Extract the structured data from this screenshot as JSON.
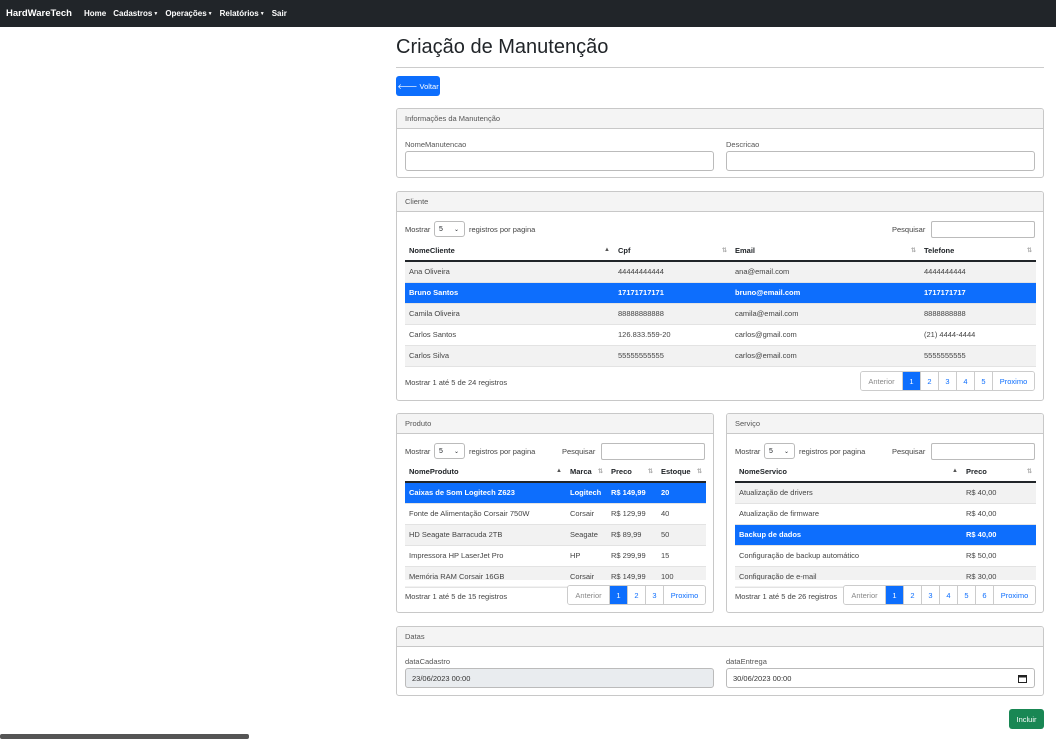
{
  "navbar": {
    "brand": "HardWareTech",
    "items": [
      {
        "label": "Home",
        "dropdown": false
      },
      {
        "label": "Cadastros",
        "dropdown": true
      },
      {
        "label": "Operações",
        "dropdown": true
      },
      {
        "label": "Relatórios",
        "dropdown": true
      },
      {
        "label": "Sair",
        "dropdown": false
      }
    ]
  },
  "page": {
    "title": "Criação de Manutenção",
    "back_label": "🡐 Voltar",
    "submit_label": "Incluir"
  },
  "info": {
    "header": "Informações da Manutenção",
    "nome_label": "NomeManutencao",
    "nome_value": "",
    "descricao_label": "Descricao",
    "descricao_value": ""
  },
  "cliente": {
    "header": "Cliente",
    "show_label": "Mostrar",
    "page_size": "5",
    "per_page_label": "registros por pagina",
    "search_label": "Pesquisar",
    "columns": [
      "NomeCliente",
      "Cpf",
      "Email",
      "Telefone"
    ],
    "rows": [
      [
        "Ana Oliveira",
        "44444444444",
        "ana@email.com",
        "4444444444"
      ],
      [
        "Bruno Santos",
        "17171717171",
        "bruno@email.com",
        "1717171717"
      ],
      [
        "Camila Oliveira",
        "88888888888",
        "camila@email.com",
        "8888888888"
      ],
      [
        "Carlos Santos",
        "126.833.559-20",
        "carlos@gmail.com",
        "(21) 4444-4444"
      ],
      [
        "Carlos Silva",
        "55555555555",
        "carlos@email.com",
        "5555555555"
      ]
    ],
    "selected_row": 1,
    "info": "Mostrar 1 até 5 de 24 registros",
    "pager": [
      "Anterior",
      "1",
      "2",
      "3",
      "4",
      "5",
      "Proximo"
    ],
    "active_page": "1"
  },
  "produto": {
    "header": "Produto",
    "show_label": "Mostrar",
    "page_size": "5",
    "per_page_label": "registros por pagina",
    "search_label": "Pesquisar",
    "columns": [
      "NomeProduto",
      "Marca",
      "Preco",
      "Estoque"
    ],
    "rows": [
      [
        "Caixas de Som Logitech Z623",
        "Logitech",
        "R$ 149,99",
        "20"
      ],
      [
        "Fonte de Alimentação Corsair 750W",
        "Corsair",
        "R$ 129,99",
        "40"
      ],
      [
        "HD Seagate Barracuda 2TB",
        "Seagate",
        "R$ 89,99",
        "50"
      ],
      [
        "Impressora HP LaserJet Pro",
        "HP",
        "R$ 299,99",
        "15"
      ],
      [
        "Memória RAM Corsair 16GB",
        "Corsair",
        "R$ 149,99",
        "100"
      ]
    ],
    "selected_row": 0,
    "info": "Mostrar 1 até 5 de 15 registros",
    "pager": [
      "Anterior",
      "1",
      "2",
      "3",
      "Proximo"
    ],
    "active_page": "1"
  },
  "servico": {
    "header": "Serviço",
    "show_label": "Mostrar",
    "page_size": "5",
    "per_page_label": "registros por pagina",
    "search_label": "Pesquisar",
    "columns": [
      "NomeServico",
      "Preco"
    ],
    "rows": [
      [
        "Atualização de drivers",
        "R$ 40,00"
      ],
      [
        "Atualização de firmware",
        "R$ 40,00"
      ],
      [
        "Backup de dados",
        "R$ 40,00"
      ],
      [
        "Configuração de backup automático",
        "R$ 50,00"
      ],
      [
        "Configuração de e-mail",
        "R$ 30,00"
      ]
    ],
    "selected_row": 2,
    "info": "Mostrar 1 até 5 de 26 registros",
    "pager": [
      "Anterior",
      "1",
      "2",
      "3",
      "4",
      "5",
      "6",
      "Proximo"
    ],
    "active_page": "1"
  },
  "datas": {
    "header": "Datas",
    "cadastro_label": "dataCadastro",
    "cadastro_value": "23/06/2023 00:00",
    "entrega_label": "dataEntrega",
    "entrega_value": "30/06/2023 00:00",
    "calendar_icon": "calendar-icon"
  },
  "colors": {
    "primary": "#0d6efd",
    "success": "#198754",
    "navbar": "#212529"
  }
}
